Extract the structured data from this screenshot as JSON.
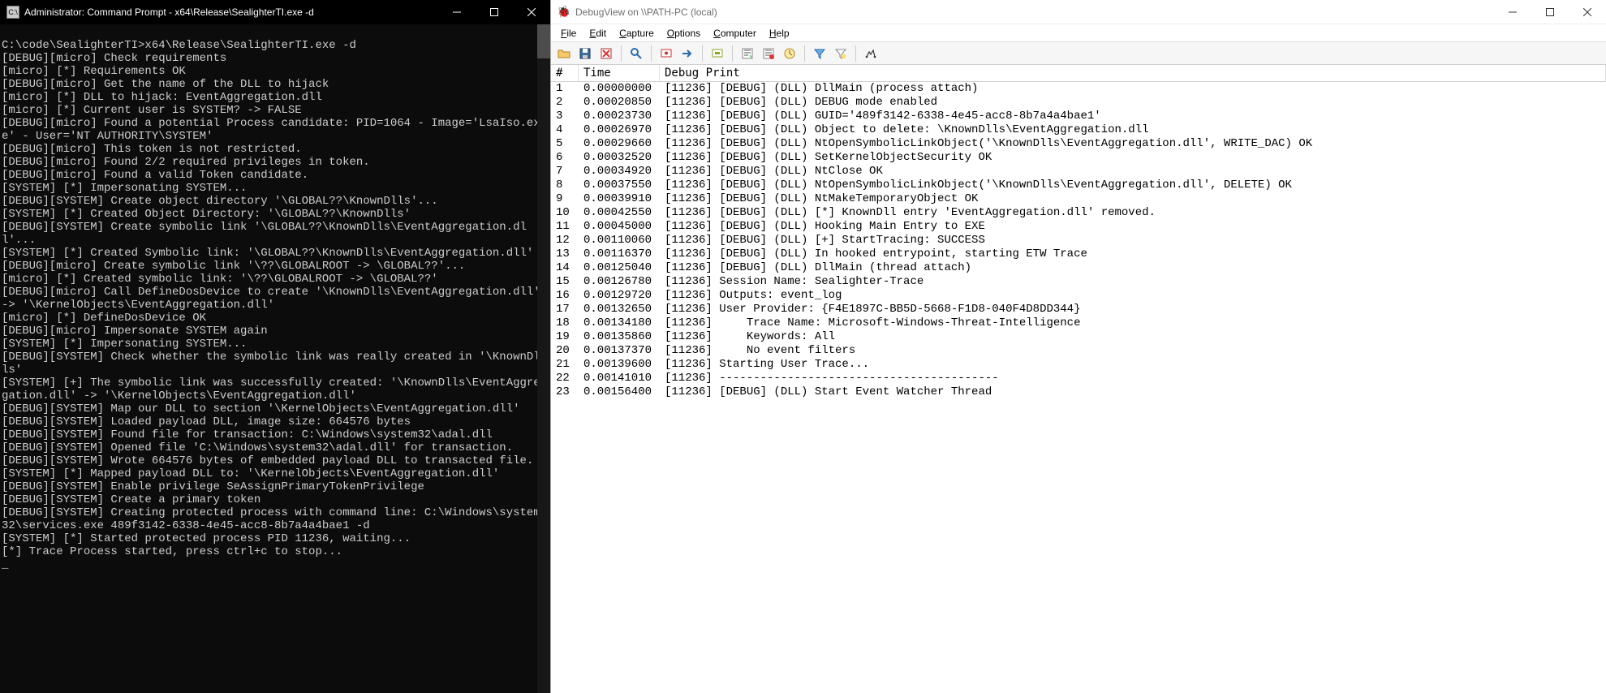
{
  "cmd": {
    "title": "Administrator: Command Prompt - x64\\Release\\SealighterTI.exe  -d",
    "icon_text": "C:\\",
    "lines": [
      "",
      "C:\\code\\SealighterTI>x64\\Release\\SealighterTI.exe -d",
      "[DEBUG][micro] Check requirements",
      "[micro] [*] Requirements OK",
      "[DEBUG][micro] Get the name of the DLL to hijack",
      "[micro] [*] DLL to hijack: EventAggregation.dll",
      "[micro] [*] Current user is SYSTEM? -> FALSE",
      "[DEBUG][micro] Found a potential Process candidate: PID=1064 - Image='LsaIso.exe' - User='NT AUTHORITY\\SYSTEM'",
      "[DEBUG][micro] This token is not restricted.",
      "[DEBUG][micro] Found 2/2 required privileges in token.",
      "[DEBUG][micro] Found a valid Token candidate.",
      "[SYSTEM] [*] Impersonating SYSTEM...",
      "[DEBUG][SYSTEM] Create object directory '\\GLOBAL??\\KnownDlls'...",
      "[SYSTEM] [*] Created Object Directory: '\\GLOBAL??\\KnownDlls'",
      "[DEBUG][SYSTEM] Create symbolic link '\\GLOBAL??\\KnownDlls\\EventAggregation.dll'...",
      "[SYSTEM] [*] Created Symbolic link: '\\GLOBAL??\\KnownDlls\\EventAggregation.dll'",
      "[DEBUG][micro] Create symbolic link '\\??\\GLOBALROOT -> \\GLOBAL??'...",
      "[micro] [*] Created symbolic link: '\\??\\GLOBALROOT -> \\GLOBAL??'",
      "[DEBUG][micro] Call DefineDosDevice to create '\\KnownDlls\\EventAggregation.dll' -> '\\KernelObjects\\EventAggregation.dll'",
      "[micro] [*] DefineDosDevice OK",
      "[DEBUG][micro] Impersonate SYSTEM again",
      "[SYSTEM] [*] Impersonating SYSTEM...",
      "[DEBUG][SYSTEM] Check whether the symbolic link was really created in '\\KnownDlls'",
      "[SYSTEM] [+] The symbolic link was successfully created: '\\KnownDlls\\EventAggregation.dll' -> '\\KernelObjects\\EventAggregation.dll'",
      "[DEBUG][SYSTEM] Map our DLL to section '\\KernelObjects\\EventAggregation.dll'",
      "[DEBUG][SYSTEM] Loaded payload DLL, image size: 664576 bytes",
      "[DEBUG][SYSTEM] Found file for transaction: C:\\Windows\\system32\\adal.dll",
      "[DEBUG][SYSTEM] Opened file 'C:\\Windows\\system32\\adal.dll' for transaction.",
      "[DEBUG][SYSTEM] Wrote 664576 bytes of embedded payload DLL to transacted file.",
      "[SYSTEM] [*] Mapped payload DLL to: '\\KernelObjects\\EventAggregation.dll'",
      "[DEBUG][SYSTEM] Enable privilege SeAssignPrimaryTokenPrivilege",
      "[DEBUG][SYSTEM] Create a primary token",
      "[DEBUG][SYSTEM] Creating protected process with command line: C:\\Windows\\system32\\services.exe 489f3142-6338-4e45-acc8-8b7a4a4bae1 -d",
      "[SYSTEM] [*] Started protected process PID 11236, waiting...",
      "[*] Trace Process started, press ctrl+c to stop...",
      "_"
    ]
  },
  "dv": {
    "title": "DebugView on \\\\PATH-PC (local)",
    "menus": [
      {
        "key": "F",
        "rest": "ile"
      },
      {
        "key": "E",
        "rest": "dit"
      },
      {
        "key": "C",
        "rest": "apture"
      },
      {
        "key": "O",
        "rest": "ptions"
      },
      {
        "key": "C",
        "rest": "omputer",
        "prefix": ""
      },
      {
        "key": "H",
        "rest": "elp"
      }
    ],
    "menu_labels": [
      "File",
      "Edit",
      "Capture",
      "Options",
      "Computer",
      "Help"
    ],
    "toolbar": [
      "open",
      "save",
      "delete",
      "sep",
      "find",
      "sep",
      "capture-win",
      "capture-arrow",
      "sep",
      "capture-kernel",
      "sep",
      "monitor",
      "monitor2",
      "clock",
      "sep",
      "filter",
      "highlight",
      "sep",
      "history"
    ],
    "header": {
      "num": "#",
      "time": "Time",
      "print": "Debug Print"
    },
    "rows": [
      {
        "n": "1",
        "t": "0.00000000",
        "p": "[11236] [DEBUG] (DLL) DllMain (process attach)"
      },
      {
        "n": "2",
        "t": "0.00020850",
        "p": "[11236] [DEBUG] (DLL) DEBUG mode enabled"
      },
      {
        "n": "3",
        "t": "0.00023730",
        "p": "[11236] [DEBUG] (DLL) GUID='489f3142-6338-4e45-acc8-8b7a4a4bae1'"
      },
      {
        "n": "4",
        "t": "0.00026970",
        "p": "[11236] [DEBUG] (DLL) Object to delete: \\KnownDlls\\EventAggregation.dll"
      },
      {
        "n": "5",
        "t": "0.00029660",
        "p": "[11236] [DEBUG] (DLL) NtOpenSymbolicLinkObject('\\KnownDlls\\EventAggregation.dll', WRITE_DAC) OK"
      },
      {
        "n": "6",
        "t": "0.00032520",
        "p": "[11236] [DEBUG] (DLL) SetKernelObjectSecurity OK"
      },
      {
        "n": "7",
        "t": "0.00034920",
        "p": "[11236] [DEBUG] (DLL) NtClose OK"
      },
      {
        "n": "8",
        "t": "0.00037550",
        "p": "[11236] [DEBUG] (DLL) NtOpenSymbolicLinkObject('\\KnownDlls\\EventAggregation.dll', DELETE) OK"
      },
      {
        "n": "9",
        "t": "0.00039910",
        "p": "[11236] [DEBUG] (DLL) NtMakeTemporaryObject OK"
      },
      {
        "n": "10",
        "t": "0.00042550",
        "p": "[11236] [DEBUG] (DLL) [*] KnownDll entry 'EventAggregation.dll' removed."
      },
      {
        "n": "11",
        "t": "0.00045000",
        "p": "[11236] [DEBUG] (DLL) Hooking Main Entry to EXE"
      },
      {
        "n": "12",
        "t": "0.00110060",
        "p": "[11236] [DEBUG] (DLL) [+] StartTracing: SUCCESS"
      },
      {
        "n": "13",
        "t": "0.00116370",
        "p": "[11236] [DEBUG] (DLL) In hooked entrypoint, starting ETW Trace"
      },
      {
        "n": "14",
        "t": "0.00125040",
        "p": "[11236] [DEBUG] (DLL) DllMain (thread attach)"
      },
      {
        "n": "15",
        "t": "0.00126780",
        "p": "[11236] Session Name: Sealighter-Trace"
      },
      {
        "n": "16",
        "t": "0.00129720",
        "p": "[11236] Outputs: event_log"
      },
      {
        "n": "17",
        "t": "0.00132650",
        "p": "[11236] User Provider: {F4E1897C-BB5D-5668-F1D8-040F4D8DD344}"
      },
      {
        "n": "18",
        "t": "0.00134180",
        "p": "[11236]     Trace Name: Microsoft-Windows-Threat-Intelligence"
      },
      {
        "n": "19",
        "t": "0.00135860",
        "p": "[11236]     Keywords: All"
      },
      {
        "n": "20",
        "t": "0.00137370",
        "p": "[11236]     No event filters"
      },
      {
        "n": "21",
        "t": "0.00139600",
        "p": "[11236] Starting User Trace..."
      },
      {
        "n": "22",
        "t": "0.00141010",
        "p": "[11236] -----------------------------------------"
      },
      {
        "n": "23",
        "t": "0.00156400",
        "p": "[11236] [DEBUG] (DLL) Start Event Watcher Thread"
      }
    ]
  }
}
